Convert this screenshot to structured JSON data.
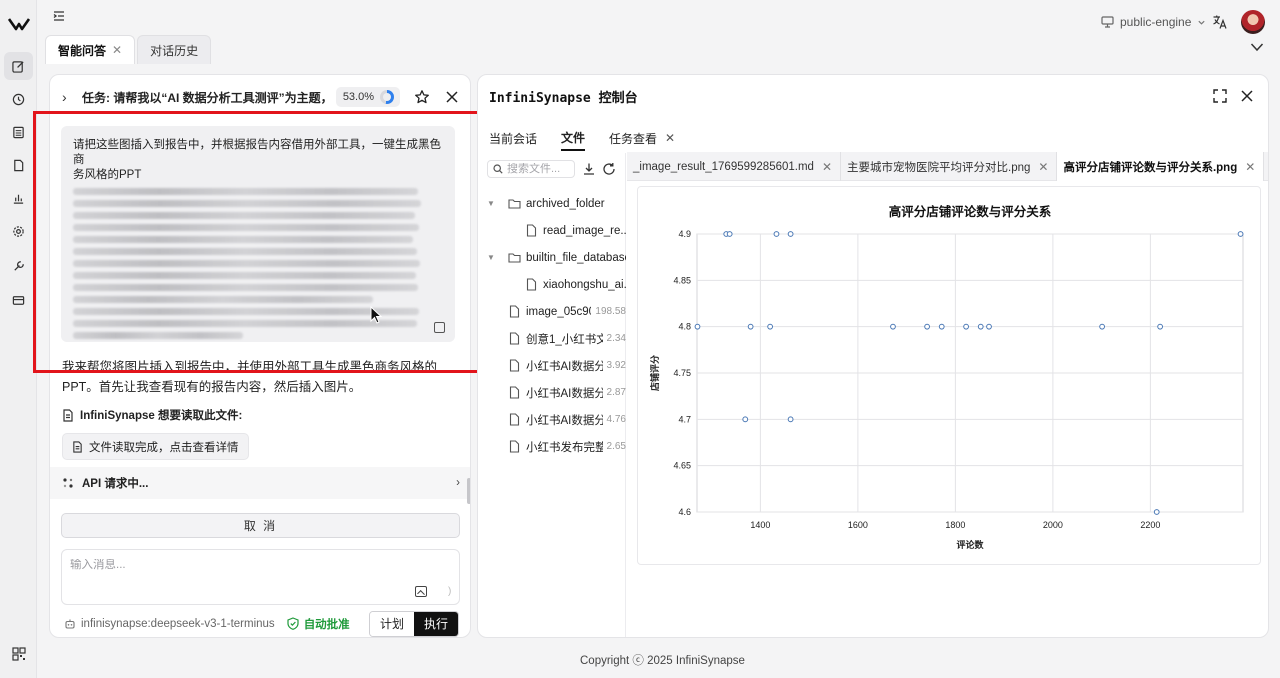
{
  "rail": {
    "items": [
      "edit-icon",
      "history-icon",
      "list-icon",
      "document-icon",
      "chart-icon",
      "gear-icon",
      "wrench-icon",
      "card-icon"
    ],
    "bottom": "qrcode-icon"
  },
  "topbar": {
    "engine": "public-engine"
  },
  "tabs": [
    {
      "label": "智能问答",
      "closable": true
    },
    {
      "label": "对话历史",
      "closable": false
    }
  ],
  "chat": {
    "task_title": "任务: 请帮我以“AI 数据分析工具测评”为主题，去...",
    "progress": "53.0%",
    "progress_fraction": 0.53,
    "user_message_line1": "请把这些图插入到报告中，并根据报告内容借用外部工具，一键生成黑色商",
    "user_message_line2": "务风格的PPT",
    "assistant_text": "我来帮您将图片插入到报告中，并使用外部工具生成黑色商务风格的PPT。首先让我查看现有的报告内容，然后插入图片。",
    "read_label": "InfiniSynapse 想要读取此文件:",
    "read_button": "文件读取完成，点击查看详情",
    "api_status": "API 请求中...",
    "cancel_label": "取 消",
    "input_placeholder": "输入消息...",
    "model": "infinisynapse:deepseek-v3-1-terminus",
    "auto_approve": "自动批准",
    "mode_plan": "计划",
    "mode_execute": "执行"
  },
  "console": {
    "title_mono": "InfiniSynapse",
    "title_cn": "控制台",
    "tabs": [
      "当前会话",
      "文件",
      "任务查看"
    ],
    "active_tab": "文件",
    "search_placeholder": "搜索文件...",
    "tree": [
      {
        "name": "archived_folder",
        "type": "folder",
        "depth": 0,
        "expanded": true
      },
      {
        "name": "read_image_re...",
        "type": "file",
        "depth": 1
      },
      {
        "name": "builtin_file_database",
        "type": "folder",
        "depth": 0,
        "expanded": true
      },
      {
        "name": "xiaohongshu_ai...",
        "type": "file",
        "depth": 1
      },
      {
        "name": "image_05c90...",
        "type": "file",
        "depth": 0,
        "size": "198.58"
      },
      {
        "name": "创意1_小红书文...",
        "type": "file",
        "depth": 0,
        "size": "2.34"
      },
      {
        "name": "小红书AI数据分...",
        "type": "file",
        "depth": 0,
        "size": "3.92"
      },
      {
        "name": "小红书AI数据分...",
        "type": "file",
        "depth": 0,
        "size": "2.87"
      },
      {
        "name": "小红书AI数据分...",
        "type": "file",
        "depth": 0,
        "size": "4.76"
      },
      {
        "name": "小红书发布完整...",
        "type": "file",
        "depth": 0,
        "size": "2.65"
      }
    ],
    "file_tabs": [
      {
        "label": "_image_result_1769599285601.md",
        "active": false
      },
      {
        "label": "主要城市宠物医院平均评分对比.png",
        "active": false
      },
      {
        "label": "高评分店铺评论数与评分关系.png",
        "active": true
      }
    ],
    "more": "···"
  },
  "chart_data": {
    "type": "scatter",
    "title": "高评分店铺评论数与评分关系",
    "xlabel": "评论数",
    "ylabel": "店铺评分",
    "xlim": [
      1270,
      2390
    ],
    "ylim": [
      4.6,
      4.9
    ],
    "xticks": [
      1400,
      1600,
      1800,
      2000,
      2200
    ],
    "yticks": [
      4.6,
      4.65,
      4.7,
      4.75,
      4.8,
      4.85,
      4.9
    ],
    "grid": true,
    "marker_color": "#4a78b5",
    "points": [
      {
        "x": 1330,
        "y": 4.9
      },
      {
        "x": 1337,
        "y": 4.9
      },
      {
        "x": 1433,
        "y": 4.9
      },
      {
        "x": 1462,
        "y": 4.9
      },
      {
        "x": 2385,
        "y": 4.9
      },
      {
        "x": 1271,
        "y": 4.8
      },
      {
        "x": 1380,
        "y": 4.8
      },
      {
        "x": 1420,
        "y": 4.8
      },
      {
        "x": 1672,
        "y": 4.8
      },
      {
        "x": 1742,
        "y": 4.8
      },
      {
        "x": 1772,
        "y": 4.8
      },
      {
        "x": 1822,
        "y": 4.8
      },
      {
        "x": 1852,
        "y": 4.8
      },
      {
        "x": 1869,
        "y": 4.8
      },
      {
        "x": 2101,
        "y": 4.8
      },
      {
        "x": 2220,
        "y": 4.8
      },
      {
        "x": 1369,
        "y": 4.7
      },
      {
        "x": 1462,
        "y": 4.7
      },
      {
        "x": 2213,
        "y": 4.6
      }
    ]
  },
  "footer": "Copyright ⓒ 2025 InfiniSynapse"
}
